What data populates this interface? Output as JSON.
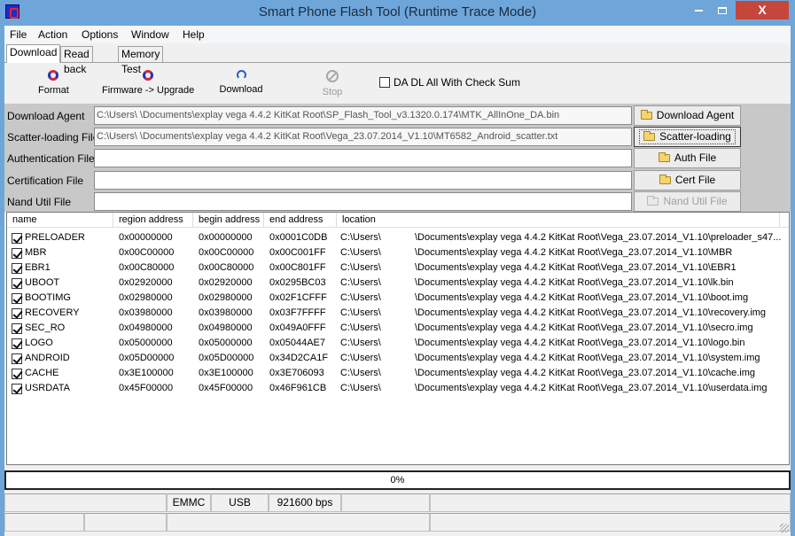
{
  "window": {
    "title": "Smart Phone Flash Tool (Runtime Trace Mode)",
    "close_label": "X"
  },
  "menu": [
    "File",
    "Action",
    "Options",
    "Window",
    "Help"
  ],
  "tabs": [
    "Download",
    "Read back",
    "Memory Test"
  ],
  "active_tab": "Download",
  "toolbar": {
    "format": "Format",
    "firmware_upgrade": "Firmware -> Upgrade",
    "download": "Download",
    "stop": "Stop",
    "checksum_label": "DA DL All With Check Sum",
    "checksum_checked": false
  },
  "files": [
    {
      "label": "Download Agent",
      "value": "C:\\Users\\            \\Documents\\explay vega 4.4.2 KitKat Root\\SP_Flash_Tool_v3.1320.0.174\\MTK_AllInOne_DA.bin",
      "button": "Download Agent"
    },
    {
      "label": "Scatter-loading File",
      "value": "C:\\Users\\            \\Documents\\explay vega 4.4.2 KitKat Root\\Vega_23.07.2014_V1.10\\MT6582_Android_scatter.txt",
      "button": "Scatter-loading"
    },
    {
      "label": "Authentication File",
      "value": "",
      "button": "Auth File"
    },
    {
      "label": "Certification File",
      "value": "",
      "button": "Cert File"
    },
    {
      "label": "Nand Util File",
      "value": "",
      "button": "Nand Util File"
    }
  ],
  "table": {
    "columns": [
      "name",
      "region address",
      "begin address",
      "end address",
      "location"
    ],
    "rows": [
      {
        "name": "PRELOADER",
        "region": "0x00000000",
        "begin": "0x00000000",
        "end": "0x0001C0DB",
        "loc": "C:\\Users\\",
        "path": "\\Documents\\explay vega 4.4.2 KitKat Root\\Vega_23.07.2014_V1.10\\preloader_s47..."
      },
      {
        "name": "MBR",
        "region": "0x00C00000",
        "begin": "0x00C00000",
        "end": "0x00C001FF",
        "loc": "C:\\Users\\",
        "path": "\\Documents\\explay vega 4.4.2 KitKat Root\\Vega_23.07.2014_V1.10\\MBR"
      },
      {
        "name": "EBR1",
        "region": "0x00C80000",
        "begin": "0x00C80000",
        "end": "0x00C801FF",
        "loc": "C:\\Users\\",
        "path": "\\Documents\\explay vega 4.4.2 KitKat Root\\Vega_23.07.2014_V1.10\\EBR1"
      },
      {
        "name": "UBOOT",
        "region": "0x02920000",
        "begin": "0x02920000",
        "end": "0x0295BC03",
        "loc": "C:\\Users\\",
        "path": "\\Documents\\explay vega 4.4.2 KitKat Root\\Vega_23.07.2014_V1.10\\lk.bin"
      },
      {
        "name": "BOOTIMG",
        "region": "0x02980000",
        "begin": "0x02980000",
        "end": "0x02F1CFFF",
        "loc": "C:\\Users\\",
        "path": "\\Documents\\explay vega 4.4.2 KitKat Root\\Vega_23.07.2014_V1.10\\boot.img"
      },
      {
        "name": "RECOVERY",
        "region": "0x03980000",
        "begin": "0x03980000",
        "end": "0x03F7FFFF",
        "loc": "C:\\Users\\",
        "path": "\\Documents\\explay vega 4.4.2 KitKat Root\\Vega_23.07.2014_V1.10\\recovery.img"
      },
      {
        "name": "SEC_RO",
        "region": "0x04980000",
        "begin": "0x04980000",
        "end": "0x049A0FFF",
        "loc": "C:\\Users\\",
        "path": "\\Documents\\explay vega 4.4.2 KitKat Root\\Vega_23.07.2014_V1.10\\secro.img"
      },
      {
        "name": "LOGO",
        "region": "0x05000000",
        "begin": "0x05000000",
        "end": "0x05044AE7",
        "loc": "C:\\Users\\",
        "path": "\\Documents\\explay vega 4.4.2 KitKat Root\\Vega_23.07.2014_V1.10\\logo.bin"
      },
      {
        "name": "ANDROID",
        "region": "0x05D00000",
        "begin": "0x05D00000",
        "end": "0x34D2CA1F",
        "loc": "C:\\Users\\",
        "path": "\\Documents\\explay vega 4.4.2 KitKat Root\\Vega_23.07.2014_V1.10\\system.img"
      },
      {
        "name": "CACHE",
        "region": "0x3E100000",
        "begin": "0x3E100000",
        "end": "0x3E706093",
        "loc": "C:\\Users\\",
        "path": "\\Documents\\explay vega 4.4.2 KitKat Root\\Vega_23.07.2014_V1.10\\cache.img"
      },
      {
        "name": "USRDATA",
        "region": "0x45F00000",
        "begin": "0x45F00000",
        "end": "0x46F961CB",
        "loc": "C:\\Users\\",
        "path": "\\Documents\\explay vega 4.4.2 KitKat Root\\Vega_23.07.2014_V1.10\\userdata.img"
      }
    ]
  },
  "progress": {
    "text": "0%",
    "fraction": 0.0
  },
  "status": {
    "storage": "EMMC",
    "port": "USB",
    "baud": "921600 bps"
  },
  "colors": {
    "title_bg": "#6ea6da",
    "close_button": "#c7463b",
    "panel_bg": "#c8c8c8"
  }
}
